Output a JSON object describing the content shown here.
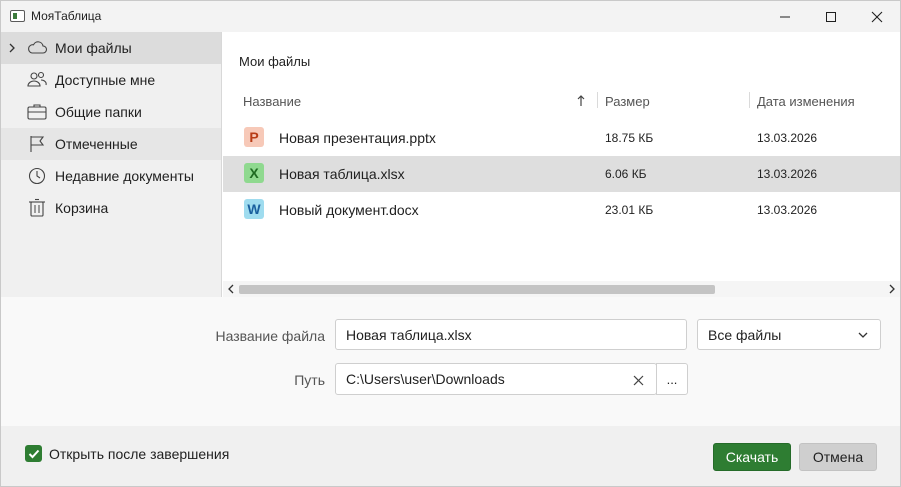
{
  "window": {
    "title": "МояТаблица",
    "controls": {
      "minimize": "minimize-icon",
      "maximize": "maximize-icon",
      "close": "close-icon"
    }
  },
  "sidebar": {
    "items": [
      {
        "label": "Мои файлы",
        "icon": "cloud-icon",
        "active": true,
        "expandable": true
      },
      {
        "label": "Доступные мне",
        "icon": "users-icon"
      },
      {
        "label": "Общие папки",
        "icon": "briefcase-icon"
      },
      {
        "label": "Отмеченные",
        "icon": "flag-icon",
        "hover": true
      },
      {
        "label": "Недавние документы",
        "icon": "clock-icon"
      },
      {
        "label": "Корзина",
        "icon": "trash-icon"
      }
    ]
  },
  "file_list": {
    "title": "Мои файлы",
    "columns": {
      "name": "Название",
      "size": "Размер",
      "date": "Дата изменения"
    },
    "sort": {
      "column": "name",
      "direction": "ascending"
    },
    "rows": [
      {
        "icon_letter": "P",
        "icon_bg": "#f7c9b8",
        "icon_fg": "#b83c16",
        "name": "Новая презентация.pptx",
        "size": "18.75 КБ",
        "date": "13.03.2026"
      },
      {
        "icon_letter": "X",
        "icon_bg": "#8fd98f",
        "icon_fg": "#1f6b22",
        "name": "Новая таблица.xlsx",
        "size": "6.06 КБ",
        "date": "13.03.2026",
        "selected": true
      },
      {
        "icon_letter": "W",
        "icon_bg": "#9fdcef",
        "icon_fg": "#1a5f9e",
        "name": "Новый документ.docx",
        "size": "23.01 КБ",
        "date": "13.03.2026"
      }
    ]
  },
  "form": {
    "filename_label": "Название файла",
    "filename_value": "Новая таблица.xlsx",
    "filetype_value": "Все файлы",
    "path_label": "Путь",
    "path_value": "C:\\Users\\user\\Downloads",
    "browse_label": "..."
  },
  "footer": {
    "open_after_label": "Открыть после завершения",
    "open_after_checked": true,
    "download_label": "Скачать",
    "cancel_label": "Отмена"
  },
  "colors": {
    "accent": "#2e7d32",
    "selection": "#dedede",
    "sidebar_active": "#dcdcdc"
  }
}
